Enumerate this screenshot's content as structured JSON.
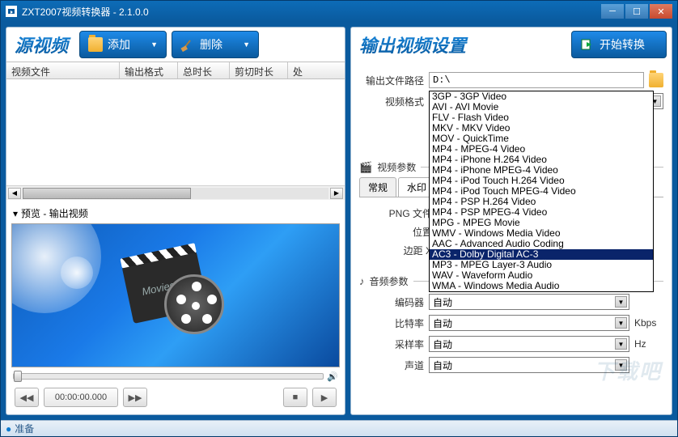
{
  "window": {
    "title": "ZXT2007视频转换器 - 2.1.0.0"
  },
  "source": {
    "title": "源视频",
    "add": "添加",
    "del": "删除",
    "columns": {
      "file": "视频文件",
      "outfmt": "输出格式",
      "duration": "总时长",
      "cut": "剪切时长",
      "proc": "处"
    },
    "preview_label": "预览 - 输出视频",
    "movies_label": "Movies",
    "timecode": "00:00:00.000"
  },
  "output": {
    "title": "输出视频设置",
    "convert": "开始转换",
    "path_label": "输出文件路径",
    "path_value": "D:\\",
    "format_label": "视频格式",
    "format_value": "3GP - 3GP Video",
    "formats": [
      "3GP - 3GP Video",
      "AVI - AVI Movie",
      "FLV - Flash Video",
      "MKV - MKV Video",
      "MOV - QuickTime",
      "MP4 - MPEG-4 Video",
      "MP4 - iPhone H.264 Video",
      "MP4 - iPhone MPEG-4 Video",
      "MP4 - iPod Touch H.264 Video",
      "MP4 - iPod Touch MPEG-4 Video",
      "MP4 - PSP H.264 Video",
      "MP4 - PSP MPEG-4 Video",
      "MPG - MPEG Movie",
      "WMV - Windows Media Video",
      "AAC - Advanced Audio Coding",
      "AC3 - Dolby Digital AC-3",
      "MP3 - MPEG Layer-3 Audio",
      "WAV - Waveform Audio",
      "WMA - Windows Media Audio"
    ],
    "selected_format_index": 15,
    "video_group": "视频参数",
    "tabs": {
      "general": "常规",
      "watermark": "水印"
    },
    "png_label": "PNG 文件",
    "pos_label": "位置",
    "margin_label": "边距 X",
    "audio_group": "音频参数",
    "encoder_label": "编码器",
    "bitrate_label": "比特率",
    "samplerate_label": "采样率",
    "channel_label": "声道",
    "auto": "自动",
    "kbps": "Kbps",
    "hz": "Hz"
  },
  "status": {
    "ready": "准备"
  },
  "watermark_bg": "下载吧"
}
